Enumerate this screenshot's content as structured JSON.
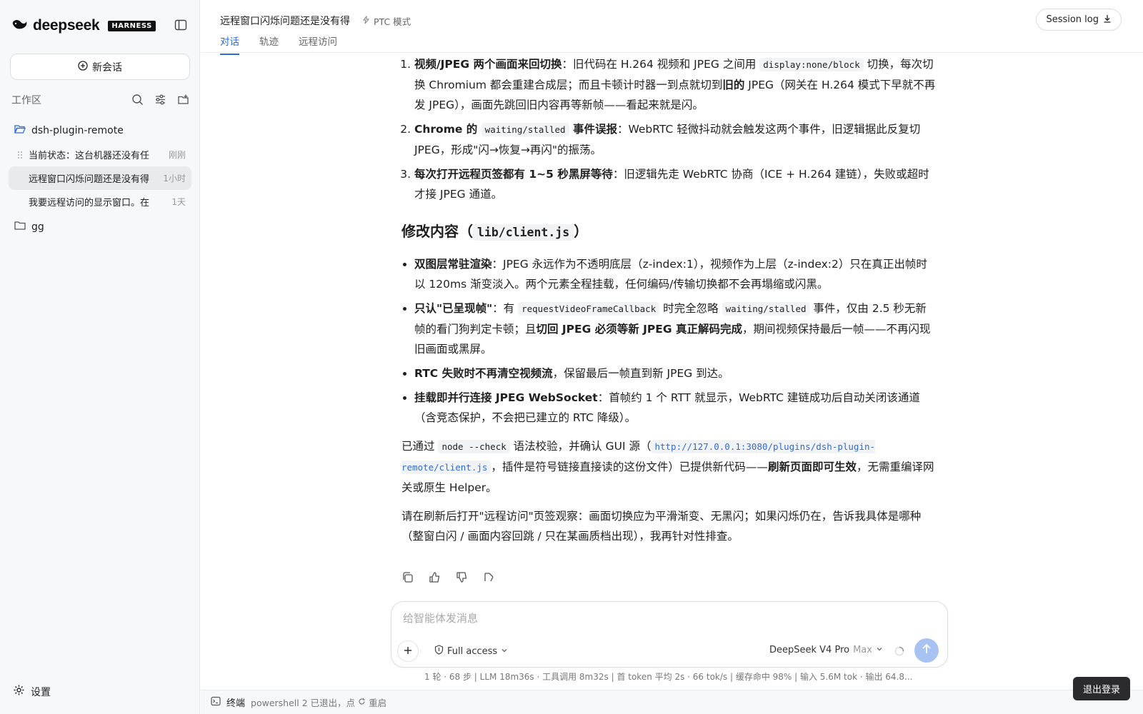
{
  "sidebar": {
    "brand": "deepseek",
    "brand_tag": "HARNESS",
    "new_chat_label": "新会话",
    "workspace_label": "工作区",
    "folders": [
      {
        "name": "dsh-plugin-remote"
      },
      {
        "name": "gg"
      }
    ],
    "chats": [
      {
        "title": "当前状态：这台机器还没有任",
        "time": "刚刚"
      },
      {
        "title": "远程窗口闪烁问题还是没有得",
        "time": "1小时"
      },
      {
        "title": "我要远程访问的显示窗口。在",
        "time": "1天"
      }
    ],
    "settings_label": "设置"
  },
  "header": {
    "title": "远程窗口闪烁问题还是没有得",
    "mode_label": "PTC 模式",
    "tabs": [
      {
        "label": "对话"
      },
      {
        "label": "轨迹"
      },
      {
        "label": "远程访问"
      }
    ],
    "session_log_label": "Session log"
  },
  "message": {
    "ol": [
      {
        "b": "视频/JPEG 两个画面来回切换",
        "t1": "：旧代码在 H.264 视频和 JPEG 之间用 ",
        "code": "display:none/block",
        "t2": " 切换，每次切换 Chromium 都会重建合成层；而且卡顿计时器一到点就切到",
        "b2": "旧的",
        "t3": " JPEG（网关在 H.264 模式下早就不再发 JPEG），画面先跳回旧内容再等新帧——看起来就是闪。"
      },
      {
        "b": "Chrome 的 ",
        "code": "waiting/stalled",
        "b2": " 事件误报",
        "t1": "：WebRTC 轻微抖动就会触发这两个事件，旧逻辑据此反复切 JPEG，形成\"闪→恢复→再闪\"的振荡。"
      },
      {
        "b": "每次打开远程页签都有 1~5 秒黑屏等待",
        "t1": "：旧逻辑先走 WebRTC 协商（ICE + H.264 建链），失败或超时才接 JPEG 通道。"
      }
    ],
    "h2_text": "修改内容（",
    "h2_code": "lib/client.js",
    "h2_end": "）",
    "ul": [
      {
        "b": "双图层常驻渲染",
        "t1": "：JPEG 永远作为不透明底层（z-index:1），视频作为上层（z-index:2）只在真正出帧时以 120ms 渐变淡入。两个元素全程挂载，任何编码/传输切换都不会再塌缩或闪黑。"
      },
      {
        "b": "只认\"已呈现帧\"",
        "t1": "：有 ",
        "code": "requestVideoFrameCallback",
        "t2": " 时完全忽略 ",
        "code2": "waiting/stalled",
        "t3": " 事件，仅由 2.5 秒无新帧的看门狗判定卡顿；且",
        "b2": "切回 JPEG 必须等新 JPEG 真正解码完成",
        "t4": "，期间视频保持最后一帧——不再闪现旧画面或黑屏。"
      },
      {
        "b": "RTC 失败时不再清空视频流",
        "t1": "，保留最后一帧直到新 JPEG 到达。"
      },
      {
        "b": "挂载即并行连接 JPEG WebSocket",
        "t1": "：首帧约 1 个 RTT 就显示，WebRTC 建链成功后自动关闭该通道（含竞态保护，不会把已建立的 RTC 降级）。"
      }
    ],
    "p1": {
      "t1": "已通过 ",
      "code": "node --check",
      "t2": " 语法校验，并确认 GUI 源（",
      "link": "http://127.0.0.1:3080/plugins/dsh-plugin-remote/client.js",
      "t3": "，插件是符号链接直接读的这份文件）已提供新代码——",
      "b": "刷新页面即可生效",
      "t4": "，无需重编译网关或原生 Helper。"
    },
    "p2": "请在刷新后打开\"远程访问\"页签观察：画面切换应为平滑渐变、无黑闪；如果闪烁仍在，告诉我具体是哪种（整窗白闪 / 画面内容回跳 / 只在某画质档出现），我再针对性排查。"
  },
  "composer": {
    "placeholder": "给智能体发消息",
    "access_label": "Full access",
    "model_label": "DeepSeek V4 Pro",
    "model_mode": "Max"
  },
  "stats_line": "1 轮 · 68 步  |  LLM 18m36s · 工具调用 8m32s  |  首 token 平均 2s · 66 tok/s  |  缓存命中 98%  |  输入 5.6M tok · 输出 64.8...",
  "bottom": {
    "terminal_label": "终端",
    "status_text": "powershell 2 已退出，点",
    "restart_label": "重启"
  },
  "logout_label": "退出登录",
  "colors": {
    "accent": "#2f6bd8",
    "send_disabled": "#a8c3f2",
    "sidebar_bg": "#f7f8fa"
  }
}
